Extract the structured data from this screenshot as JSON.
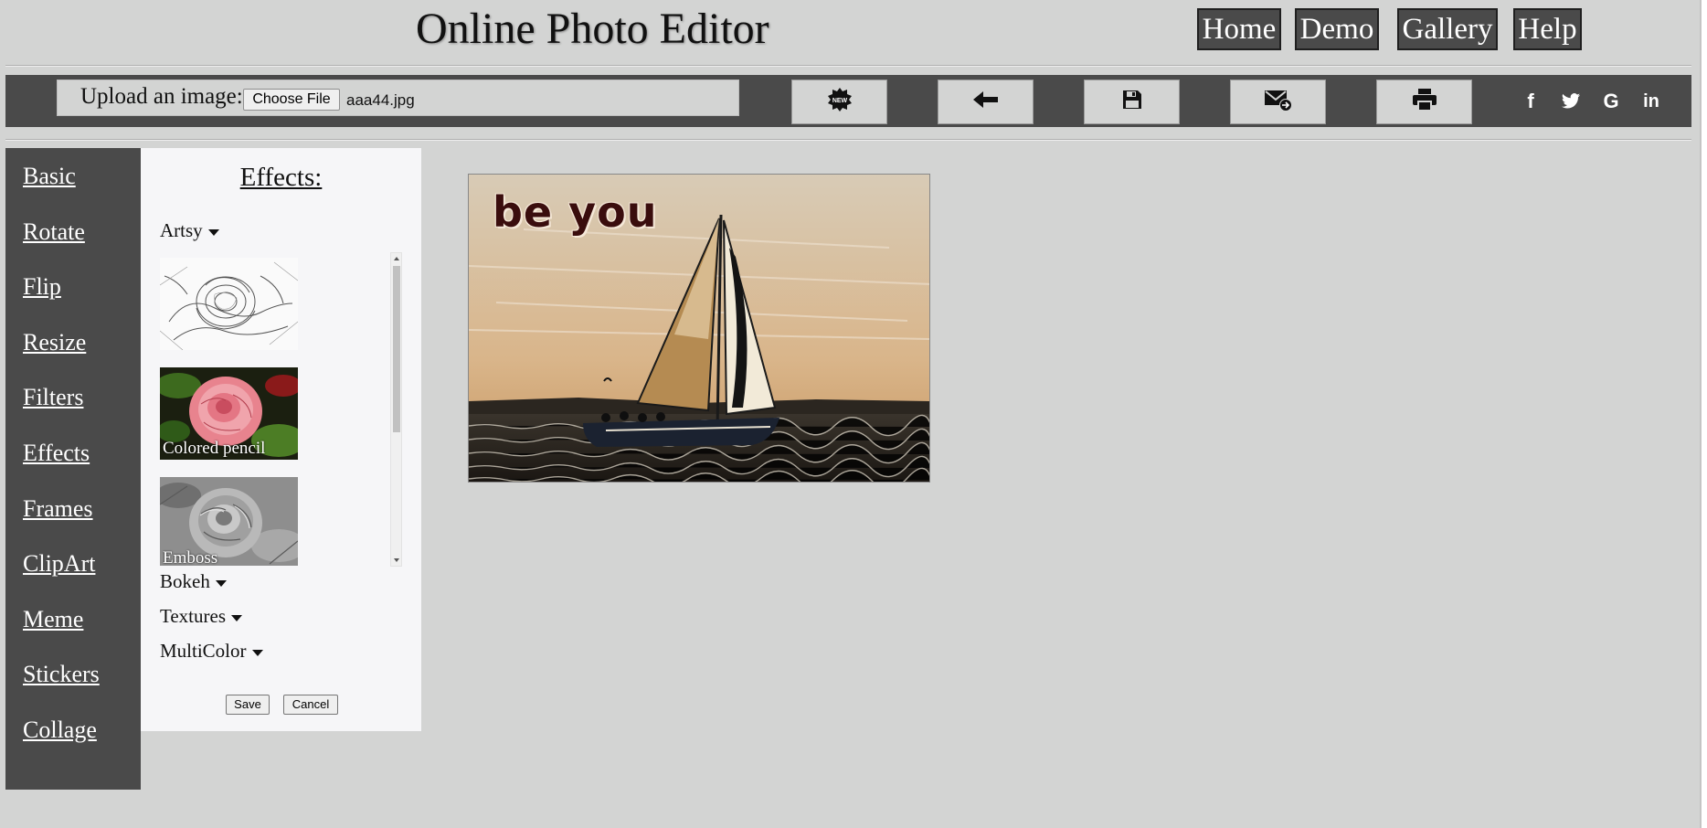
{
  "header": {
    "title": "Online Photo Editor",
    "nav": [
      {
        "label": "Home"
      },
      {
        "label": "Demo"
      },
      {
        "label": "Gallery"
      },
      {
        "label": "Help"
      }
    ]
  },
  "toolbar": {
    "upload_label": "Upload an image:",
    "choose_file_label": "Choose File",
    "file_name": "aaa44.jpg",
    "tools": [
      "new-icon",
      "back-arrow-icon",
      "save-disk-icon",
      "email-icon",
      "print-icon"
    ],
    "social": [
      "f",
      "twitter-icon",
      "G",
      "in"
    ]
  },
  "sidebar": {
    "items": [
      {
        "label": "Basic"
      },
      {
        "label": "Rotate"
      },
      {
        "label": "Flip"
      },
      {
        "label": "Resize"
      },
      {
        "label": "Filters"
      },
      {
        "label": "Effects"
      },
      {
        "label": "Frames"
      },
      {
        "label": "ClipArt"
      },
      {
        "label": "Meme"
      },
      {
        "label": "Stickers"
      },
      {
        "label": "Collage"
      }
    ]
  },
  "effects": {
    "title": "Effects:",
    "categories": [
      {
        "label": "Artsy"
      },
      {
        "label": "Bokeh"
      },
      {
        "label": "Textures"
      },
      {
        "label": "MultiColor"
      }
    ],
    "thumbnails": [
      {
        "label": ""
      },
      {
        "label": "Colored pencil"
      },
      {
        "label": "Emboss"
      }
    ],
    "save_label": "Save",
    "cancel_label": "Cancel"
  },
  "image": {
    "overlay_text": "be you"
  },
  "colors": {
    "background": "#d3d4d3",
    "dark_panel": "#4a4a4a",
    "panel_light": "#f6f6f8"
  }
}
